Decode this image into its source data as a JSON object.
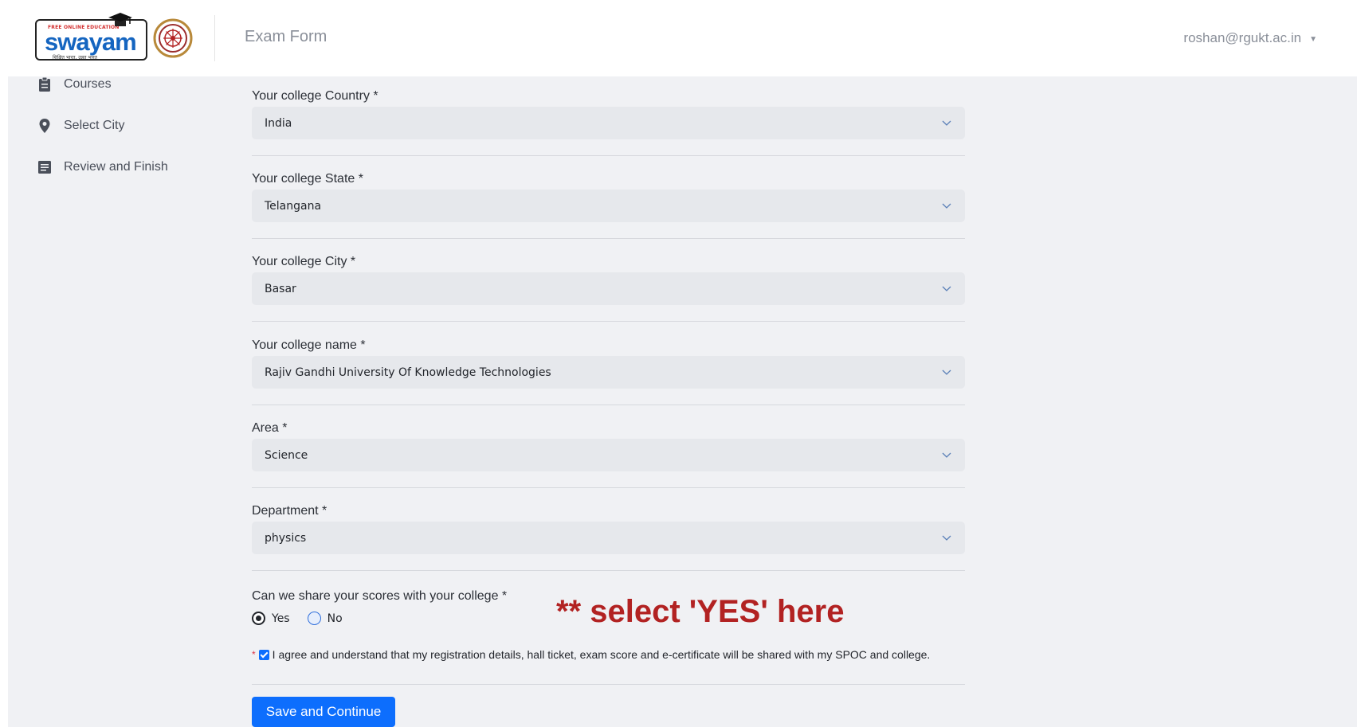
{
  "header": {
    "logo_tagline": "FREE ONLINE EDUCATION",
    "logo_text": "swayam",
    "logo_subtext": "शिक्षित भारत, उन्नत भारत",
    "page_title": "Exam Form",
    "user_email": "roshan@rgukt.ac.in"
  },
  "sidebar": {
    "items": [
      {
        "label": "Courses",
        "icon": "clipboard-icon"
      },
      {
        "label": "Select City",
        "icon": "location-pin-icon"
      },
      {
        "label": "Review and Finish",
        "icon": "list-document-icon"
      }
    ]
  },
  "form": {
    "fields": [
      {
        "label": "Your college Country *",
        "value": "India"
      },
      {
        "label": "Your college State *",
        "value": "Telangana"
      },
      {
        "label": "Your college City *",
        "value": "Basar"
      },
      {
        "label": "Your college name *",
        "value": "Rajiv Gandhi University Of Knowledge Technologies"
      },
      {
        "label": "Area *",
        "value": "Science"
      },
      {
        "label": "Department *",
        "value": "physics"
      }
    ],
    "share_question": "Can we share your scores with your college *",
    "share_options": [
      {
        "label": "Yes",
        "selected": true
      },
      {
        "label": "No",
        "selected": false
      }
    ],
    "agreement_star": "*",
    "agreement_text": "I agree and understand that my registration details, hall ticket, exam score and e-certificate will be shared with my SPOC and college.",
    "agreement_checked": true,
    "submit_label": "Save and Continue"
  },
  "annotation": "** select 'YES' here",
  "colors": {
    "primary": "#0d6efd",
    "annotation": "#b22222",
    "background": "#f0f1f4",
    "select_bg": "#e6e8ec"
  }
}
